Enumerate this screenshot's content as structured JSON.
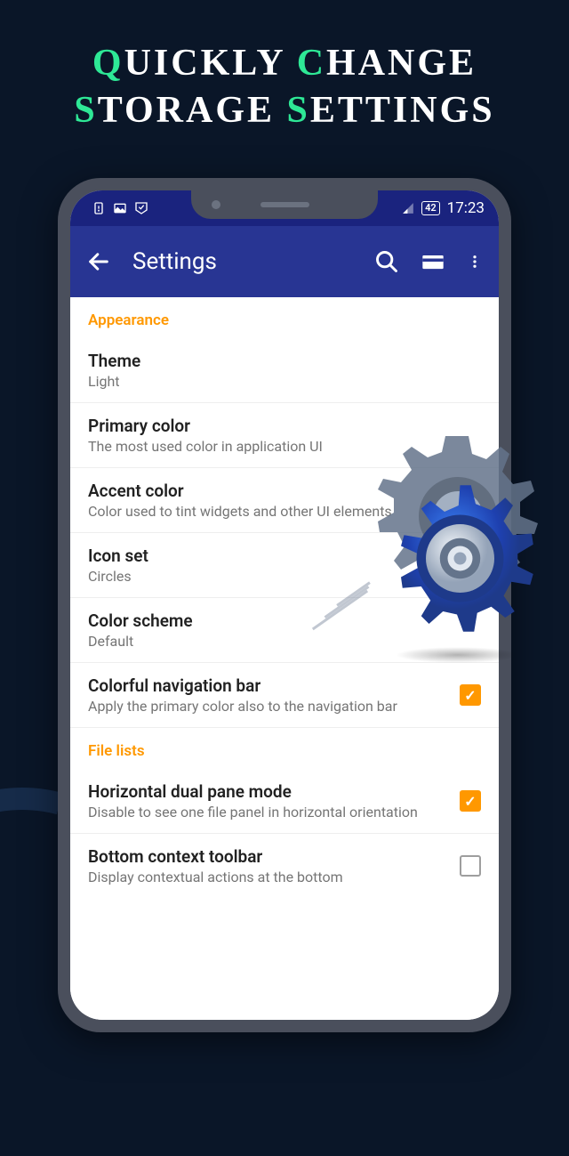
{
  "promo": {
    "line1": {
      "first": "Q",
      "rest": "UICKLY ",
      "first2": "C",
      "rest2": "HANGE"
    },
    "line2": {
      "first": "S",
      "rest": "TORAGE ",
      "first2": "S",
      "rest2": "ETTINGS"
    }
  },
  "statusbar": {
    "battery": "42",
    "time": "17:23"
  },
  "appbar": {
    "title": "Settings"
  },
  "sections": {
    "appearance": {
      "header": "Appearance",
      "theme": {
        "title": "Theme",
        "sub": "Light"
      },
      "primary": {
        "title": "Primary color",
        "sub": "The most used color in application UI"
      },
      "accent": {
        "title": "Accent color",
        "sub": "Color used to tint widgets and other UI elements"
      },
      "iconset": {
        "title": "Icon set",
        "sub": "Circles"
      },
      "scheme": {
        "title": "Color scheme",
        "sub": "Default"
      },
      "colornav": {
        "title": "Colorful navigation bar",
        "sub": "Apply the primary color also to the navigation bar",
        "checked": true
      }
    },
    "filelists": {
      "header": "File lists",
      "dualpane": {
        "title": "Horizontal dual pane mode",
        "sub": "Disable to see one file panel in horizontal orientation",
        "checked": true
      },
      "bottomtoolbar": {
        "title": "Bottom context toolbar",
        "sub": "Display contextual actions at the bottom",
        "checked": false
      }
    }
  }
}
